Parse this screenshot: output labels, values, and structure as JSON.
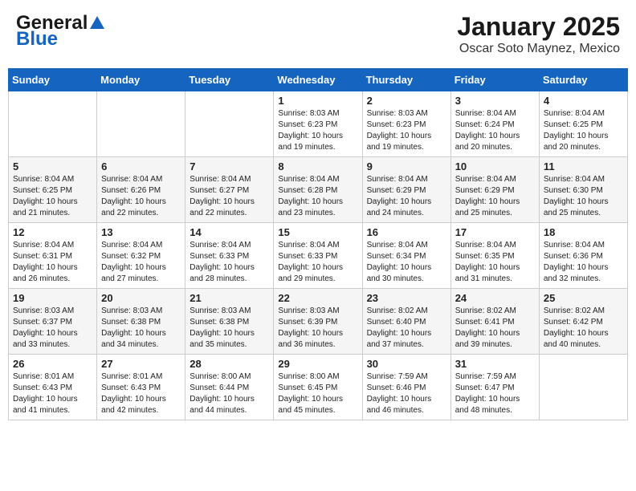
{
  "header": {
    "logo_general": "General",
    "logo_blue": "Blue",
    "title": "January 2025",
    "subtitle": "Oscar Soto Maynez, Mexico"
  },
  "days_of_week": [
    "Sunday",
    "Monday",
    "Tuesday",
    "Wednesday",
    "Thursday",
    "Friday",
    "Saturday"
  ],
  "weeks": [
    [
      {
        "day": "",
        "info": ""
      },
      {
        "day": "",
        "info": ""
      },
      {
        "day": "",
        "info": ""
      },
      {
        "day": "1",
        "info": "Sunrise: 8:03 AM\nSunset: 6:23 PM\nDaylight: 10 hours\nand 19 minutes."
      },
      {
        "day": "2",
        "info": "Sunrise: 8:03 AM\nSunset: 6:23 PM\nDaylight: 10 hours\nand 19 minutes."
      },
      {
        "day": "3",
        "info": "Sunrise: 8:04 AM\nSunset: 6:24 PM\nDaylight: 10 hours\nand 20 minutes."
      },
      {
        "day": "4",
        "info": "Sunrise: 8:04 AM\nSunset: 6:25 PM\nDaylight: 10 hours\nand 20 minutes."
      }
    ],
    [
      {
        "day": "5",
        "info": "Sunrise: 8:04 AM\nSunset: 6:25 PM\nDaylight: 10 hours\nand 21 minutes."
      },
      {
        "day": "6",
        "info": "Sunrise: 8:04 AM\nSunset: 6:26 PM\nDaylight: 10 hours\nand 22 minutes."
      },
      {
        "day": "7",
        "info": "Sunrise: 8:04 AM\nSunset: 6:27 PM\nDaylight: 10 hours\nand 22 minutes."
      },
      {
        "day": "8",
        "info": "Sunrise: 8:04 AM\nSunset: 6:28 PM\nDaylight: 10 hours\nand 23 minutes."
      },
      {
        "day": "9",
        "info": "Sunrise: 8:04 AM\nSunset: 6:29 PM\nDaylight: 10 hours\nand 24 minutes."
      },
      {
        "day": "10",
        "info": "Sunrise: 8:04 AM\nSunset: 6:29 PM\nDaylight: 10 hours\nand 25 minutes."
      },
      {
        "day": "11",
        "info": "Sunrise: 8:04 AM\nSunset: 6:30 PM\nDaylight: 10 hours\nand 25 minutes."
      }
    ],
    [
      {
        "day": "12",
        "info": "Sunrise: 8:04 AM\nSunset: 6:31 PM\nDaylight: 10 hours\nand 26 minutes."
      },
      {
        "day": "13",
        "info": "Sunrise: 8:04 AM\nSunset: 6:32 PM\nDaylight: 10 hours\nand 27 minutes."
      },
      {
        "day": "14",
        "info": "Sunrise: 8:04 AM\nSunset: 6:33 PM\nDaylight: 10 hours\nand 28 minutes."
      },
      {
        "day": "15",
        "info": "Sunrise: 8:04 AM\nSunset: 6:33 PM\nDaylight: 10 hours\nand 29 minutes."
      },
      {
        "day": "16",
        "info": "Sunrise: 8:04 AM\nSunset: 6:34 PM\nDaylight: 10 hours\nand 30 minutes."
      },
      {
        "day": "17",
        "info": "Sunrise: 8:04 AM\nSunset: 6:35 PM\nDaylight: 10 hours\nand 31 minutes."
      },
      {
        "day": "18",
        "info": "Sunrise: 8:04 AM\nSunset: 6:36 PM\nDaylight: 10 hours\nand 32 minutes."
      }
    ],
    [
      {
        "day": "19",
        "info": "Sunrise: 8:03 AM\nSunset: 6:37 PM\nDaylight: 10 hours\nand 33 minutes."
      },
      {
        "day": "20",
        "info": "Sunrise: 8:03 AM\nSunset: 6:38 PM\nDaylight: 10 hours\nand 34 minutes."
      },
      {
        "day": "21",
        "info": "Sunrise: 8:03 AM\nSunset: 6:38 PM\nDaylight: 10 hours\nand 35 minutes."
      },
      {
        "day": "22",
        "info": "Sunrise: 8:03 AM\nSunset: 6:39 PM\nDaylight: 10 hours\nand 36 minutes."
      },
      {
        "day": "23",
        "info": "Sunrise: 8:02 AM\nSunset: 6:40 PM\nDaylight: 10 hours\nand 37 minutes."
      },
      {
        "day": "24",
        "info": "Sunrise: 8:02 AM\nSunset: 6:41 PM\nDaylight: 10 hours\nand 39 minutes."
      },
      {
        "day": "25",
        "info": "Sunrise: 8:02 AM\nSunset: 6:42 PM\nDaylight: 10 hours\nand 40 minutes."
      }
    ],
    [
      {
        "day": "26",
        "info": "Sunrise: 8:01 AM\nSunset: 6:43 PM\nDaylight: 10 hours\nand 41 minutes."
      },
      {
        "day": "27",
        "info": "Sunrise: 8:01 AM\nSunset: 6:43 PM\nDaylight: 10 hours\nand 42 minutes."
      },
      {
        "day": "28",
        "info": "Sunrise: 8:00 AM\nSunset: 6:44 PM\nDaylight: 10 hours\nand 44 minutes."
      },
      {
        "day": "29",
        "info": "Sunrise: 8:00 AM\nSunset: 6:45 PM\nDaylight: 10 hours\nand 45 minutes."
      },
      {
        "day": "30",
        "info": "Sunrise: 7:59 AM\nSunset: 6:46 PM\nDaylight: 10 hours\nand 46 minutes."
      },
      {
        "day": "31",
        "info": "Sunrise: 7:59 AM\nSunset: 6:47 PM\nDaylight: 10 hours\nand 48 minutes."
      },
      {
        "day": "",
        "info": ""
      }
    ]
  ]
}
